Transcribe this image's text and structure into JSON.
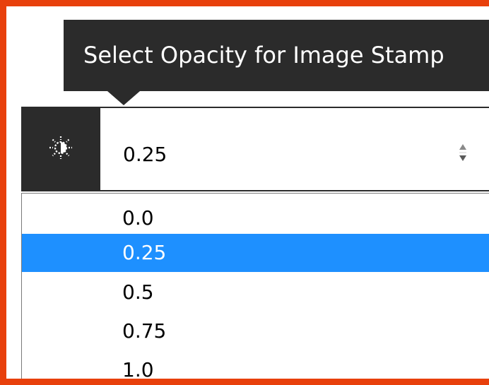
{
  "tooltip": {
    "text": "Select Opacity for Image Stamp"
  },
  "opacity_select": {
    "icon": "brightness-icon",
    "current_value": "0.25",
    "options": [
      {
        "label": "0.0",
        "selected": false
      },
      {
        "label": "0.25",
        "selected": true
      },
      {
        "label": "0.5",
        "selected": false
      },
      {
        "label": "0.75",
        "selected": false
      },
      {
        "label": "1.0",
        "selected": false
      }
    ]
  },
  "colors": {
    "frame_border": "#e8400c",
    "dark": "#2b2b2b",
    "selection": "#1e90ff"
  }
}
